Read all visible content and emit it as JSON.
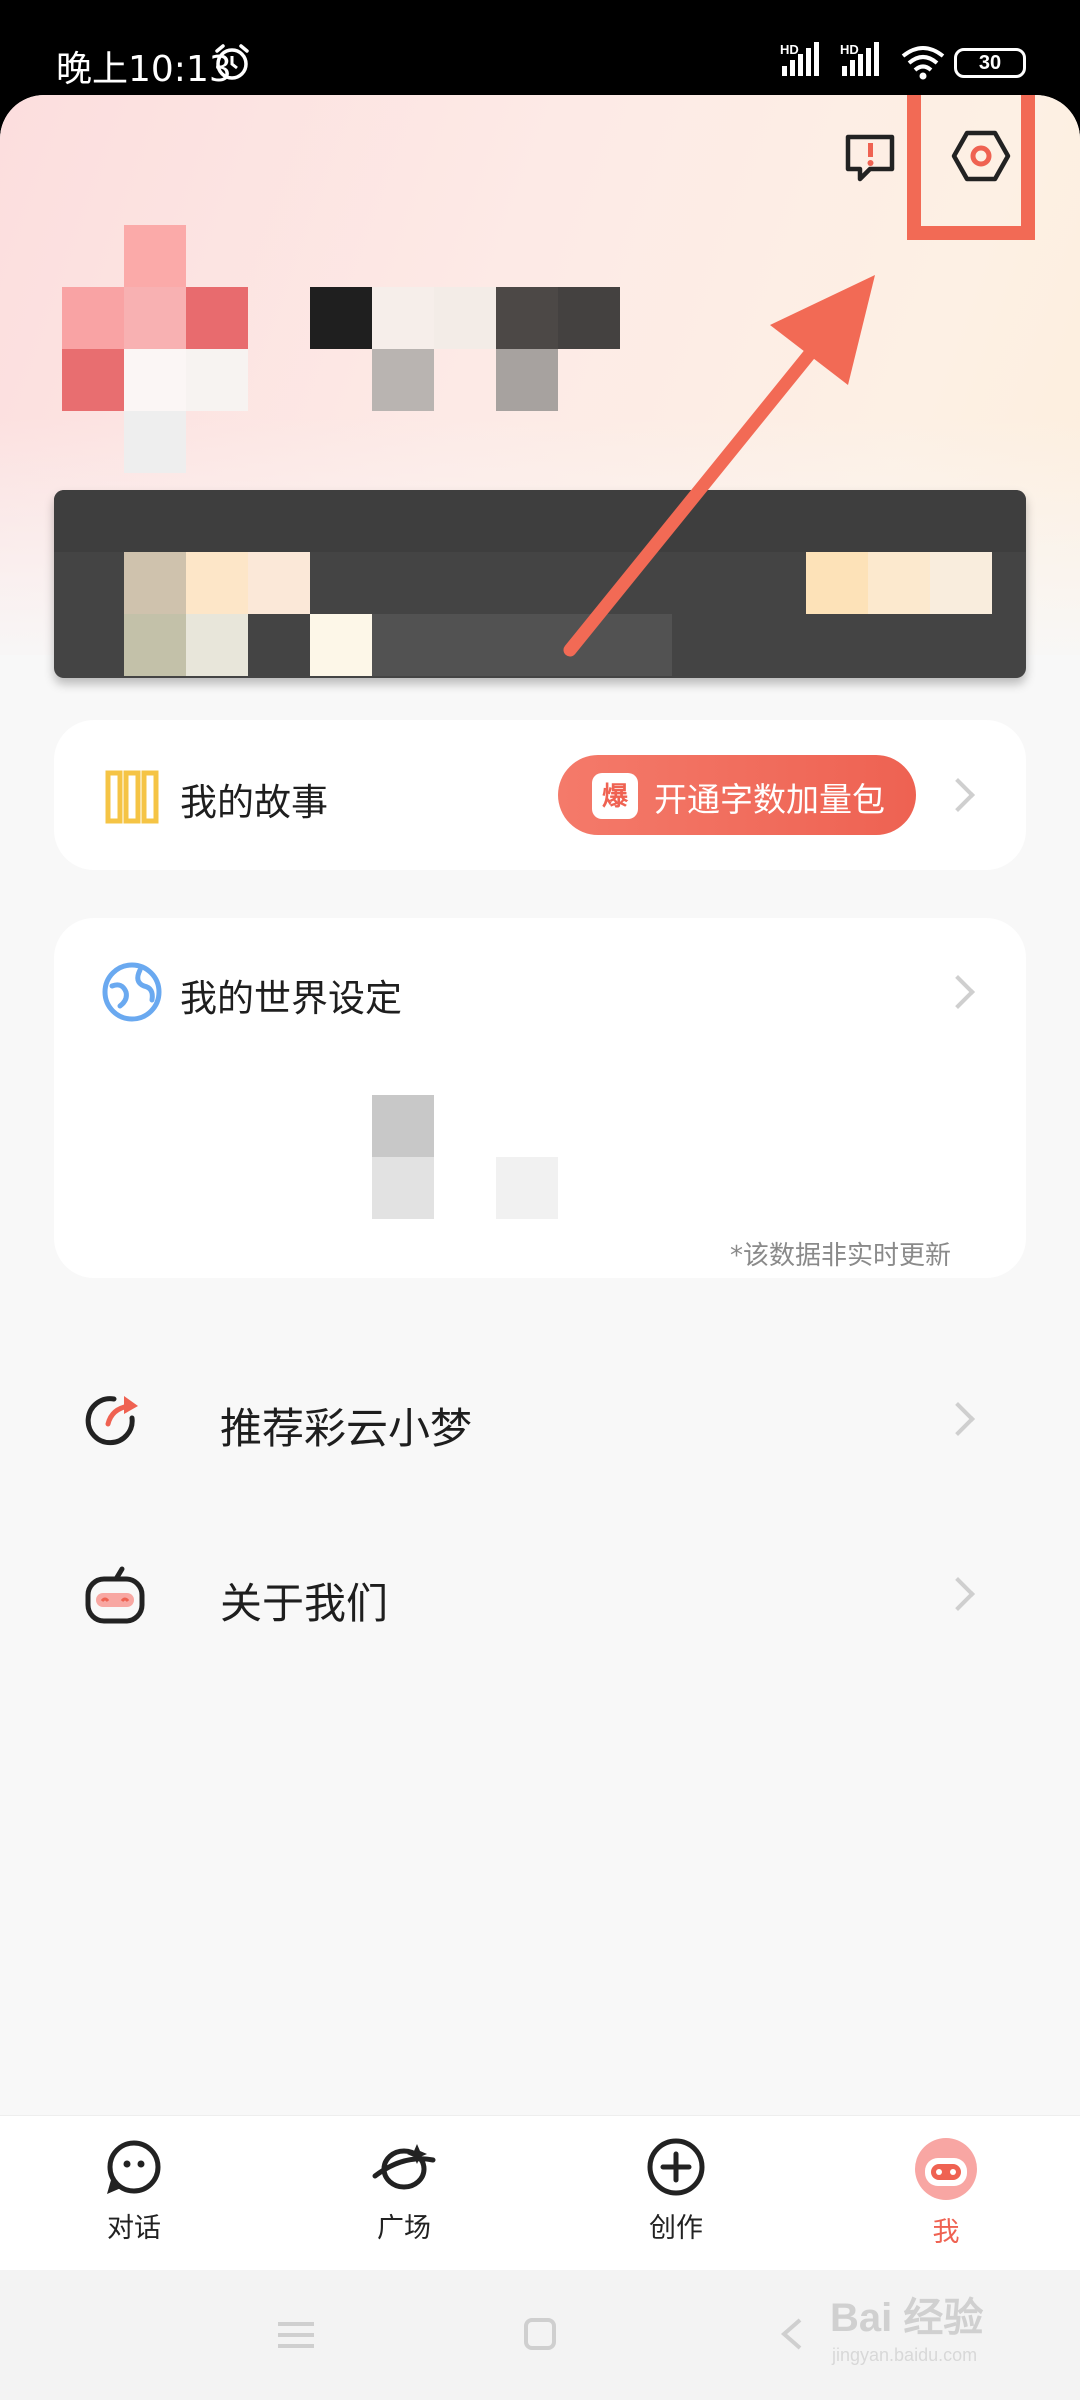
{
  "status_bar": {
    "time": "晚上10:13",
    "signal_label_1": "HD",
    "signal_label_2": "HD",
    "battery": "30"
  },
  "header": {
    "message_icon": "message-alert-icon",
    "settings_icon": "settings-hexagon-icon",
    "annotation_color": "#f26a55"
  },
  "story_card": {
    "label": "我的故事",
    "badge": "爆",
    "button_label": "开通字数加量包"
  },
  "world_card": {
    "label": "我的世界设定",
    "note": "*该数据非实时更新"
  },
  "menu": [
    {
      "label": "推荐彩云小梦",
      "icon": "share-arrow-icon"
    },
    {
      "label": "关于我们",
      "icon": "robot-face-icon"
    }
  ],
  "tabs": [
    {
      "label": "对话",
      "icon": "chat-face-icon"
    },
    {
      "label": "广场",
      "icon": "plaza-icon"
    },
    {
      "label": "创作",
      "icon": "plus-circle-icon"
    },
    {
      "label": "我",
      "icon": "avatar-icon",
      "active": true
    }
  ],
  "watermark": {
    "text": "Bai 经验",
    "url": "jingyan.baidu.com"
  },
  "colors": {
    "accent": "#ef6252",
    "background": "#f8f8f8"
  }
}
